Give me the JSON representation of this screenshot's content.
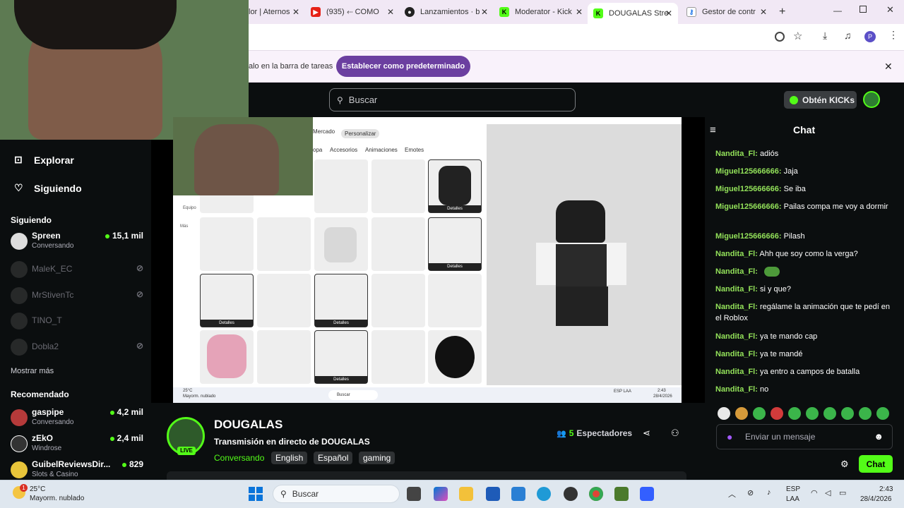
{
  "browser": {
    "tabs": [
      {
        "label": "lor | Aternos"
      },
      {
        "label": "(935) ⬸ COMO"
      },
      {
        "label": "Lanzamientos · b"
      },
      {
        "label": "Moderator - Kick"
      },
      {
        "label": "DOUGALAS Stre"
      },
      {
        "label": "Gestor de contr"
      }
    ],
    "infobar_text": "alo en la barra de tareas",
    "infobar_button": "Establecer como predeterminado",
    "profile_letter": "P"
  },
  "kick": {
    "search_placeholder": "Buscar",
    "get_kicks": "Obtén KICKs",
    "nav": {
      "explore": "Explorar",
      "following": "Siguiendo"
    },
    "following_title": "Siguiendo",
    "following": [
      {
        "name": "Spreen",
        "sub": "Conversando",
        "viewers": "15,1 mil",
        "live": true
      },
      {
        "name": "MaleK_EC",
        "live": false
      },
      {
        "name": "MrStivenTc",
        "live": false
      },
      {
        "name": "TINO_T",
        "live": false
      },
      {
        "name": "Dobla2",
        "live": false
      }
    ],
    "show_more": "Mostrar más",
    "recommended_title": "Recomendado",
    "recommended": [
      {
        "name": "gaspipe",
        "sub": "Conversando",
        "viewers": "4,2 mil"
      },
      {
        "name": "zEkO",
        "sub": "Windrose",
        "viewers": "2,4 mil"
      },
      {
        "name": "GuibelReviewsDir...",
        "sub": "Slots & Casino",
        "viewers": "829"
      }
    ],
    "stream": {
      "channel": "DOUGALAS",
      "title": "Transmisión en directo de DOUGALAS",
      "category": "Conversando",
      "tags": [
        "English",
        "Español",
        "gaming"
      ],
      "live_badge": "LIVE",
      "viewers_count": "5",
      "viewers_label": "Espectadores"
    },
    "chat": {
      "title": "Chat",
      "messages": [
        {
          "user": "Nandita_Fl:",
          "text": "adiós"
        },
        {
          "user": "Miguel125666666:",
          "text": "Jaja"
        },
        {
          "user": "Miguel125666666:",
          "text": "Se iba"
        },
        {
          "user": "Miguel125666666:",
          "text": "Pailas compa me voy a dormir"
        },
        {
          "user": "Miguel125666666:",
          "text": "Pilash"
        },
        {
          "user": "Nandita_Fl:",
          "text": "Ahh que soy como la verga?"
        },
        {
          "user": "Nandita_Fl:",
          "text": ""
        },
        {
          "user": "Nandita_Fl:",
          "text": "si y que?"
        },
        {
          "user": "Nandita_Fl:",
          "text": "regálame la animación que te pedí en el Roblox"
        },
        {
          "user": "Nandita_Fl:",
          "text": "ya te mando cap"
        },
        {
          "user": "Nandita_Fl:",
          "text": "ya te mandé"
        },
        {
          "user": "Nandita_Fl:",
          "text": "ya entro a campos de batalla"
        },
        {
          "user": "Nandita_Fl:",
          "text": "no"
        }
      ],
      "input_placeholder": "Enviar un mensaje",
      "send_button": "Chat"
    }
  },
  "roblox": {
    "tabs": [
      "Mercado",
      "Personalizar"
    ],
    "subtabs": [
      "opa",
      "Accesorios",
      "Animaciones",
      "Emotes"
    ],
    "detail_label": "Detalles",
    "side_labels": [
      "Equipo",
      "Más"
    ]
  },
  "inner_taskbar": {
    "weather": "25°C",
    "weather_sub": "Mayorm. nublado",
    "search": "Buscar",
    "lang": "ESP LAA",
    "time": "2:43",
    "date": "28/4/2026"
  },
  "windows": {
    "weather_temp": "25°C",
    "weather_desc": "Mayorm. nublado",
    "weather_badge": "1",
    "search": "Buscar",
    "lang1": "ESP",
    "lang2": "LAA",
    "time": "2:43",
    "date": "28/4/2026"
  },
  "colors": {
    "kick_green": "#53fc18",
    "chat_user": "#93e25a",
    "purple_btn": "#6b3fa0"
  }
}
